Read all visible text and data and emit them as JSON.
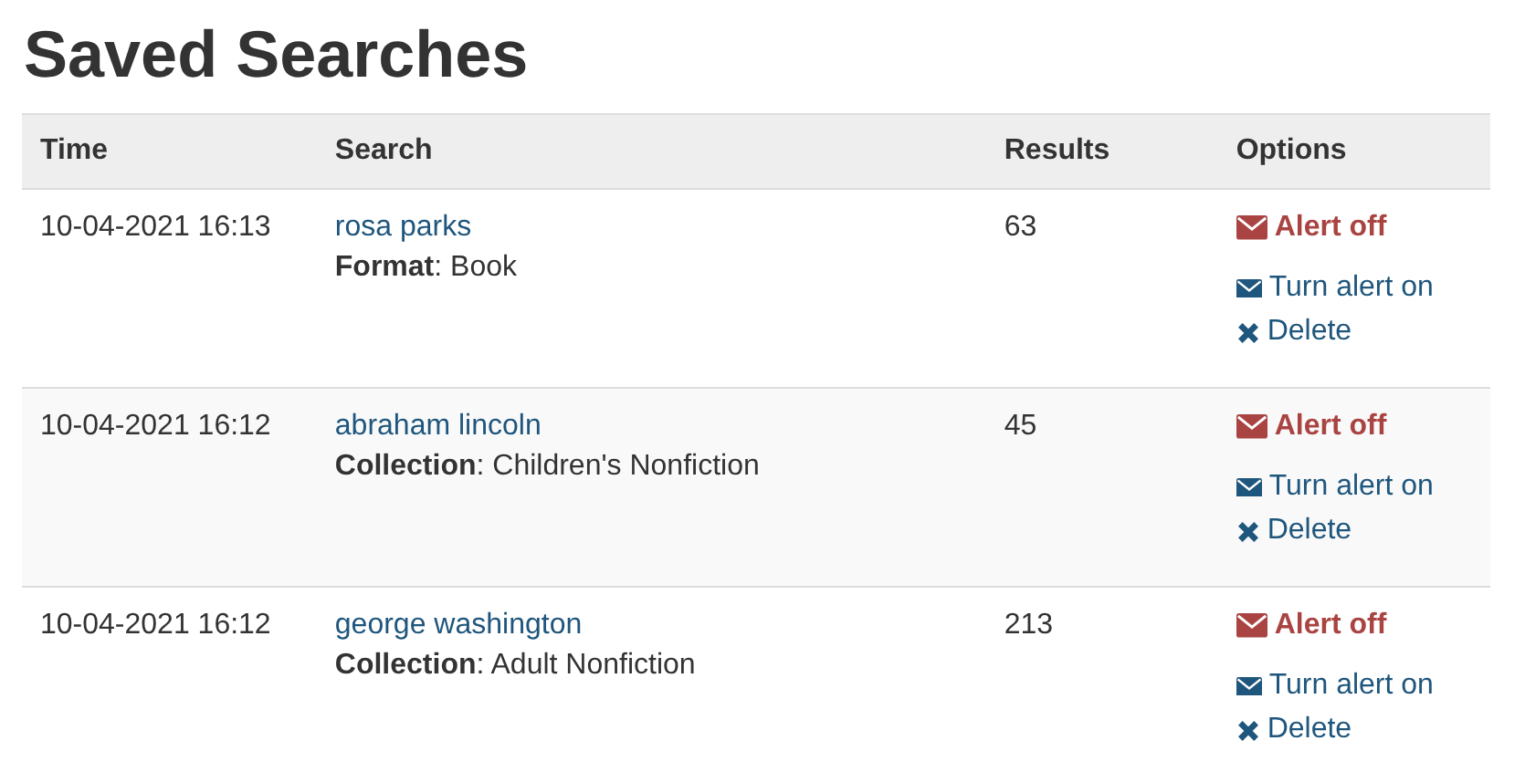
{
  "title": "Saved Searches",
  "columns": [
    "Time",
    "Search",
    "Results",
    "Options"
  ],
  "rows": [
    {
      "time": "10-04-2021 16:13",
      "search": "rosa parks",
      "filter": "**Format**: Book",
      "results": "63",
      "alert_on": false,
      "alert_status": "Alert off",
      "toggle_action": "Turn alert on",
      "delete": "Delete"
    },
    {
      "time": "10-04-2021 16:12",
      "search": "abraham lincoln",
      "filter": "**Collection**: Children's Nonfiction",
      "results": "45",
      "alert_on": false,
      "alert_status": "Alert off",
      "toggle_action": "Turn alert on",
      "delete": "Delete"
    },
    {
      "time": "10-04-2021 16:12",
      "search": "george washington",
      "filter": "**Collection**: Adult Nonfiction",
      "results": "213",
      "alert_on": false,
      "alert_status": "Alert off",
      "toggle_action": "Turn alert on",
      "delete": "Delete"
    }
  ]
}
